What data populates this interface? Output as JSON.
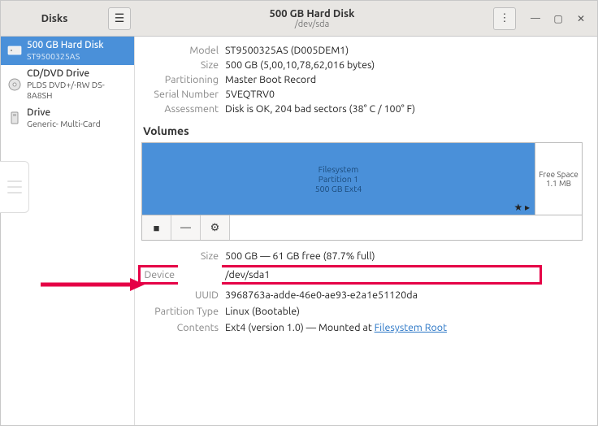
{
  "titlebar": {
    "left_title": "Disks",
    "center_title": "500 GB Hard Disk",
    "center_subtitle": "/dev/sda"
  },
  "sidebar": {
    "items": [
      {
        "main": "500 GB Hard Disk",
        "sub": "ST9500325AS"
      },
      {
        "main": "CD/DVD Drive",
        "sub": "PLDS DVD+/-RW DS-8A8SH"
      },
      {
        "main": "Drive",
        "sub": "Generic- Multi-Card"
      }
    ]
  },
  "disk_props": {
    "model_label": "Model",
    "model": "ST9500325AS (D005DEM1)",
    "size_label": "Size",
    "size": "500 GB (5,00,10,78,62,016 bytes)",
    "partitioning_label": "Partitioning",
    "partitioning": "Master Boot Record",
    "serial_label": "Serial Number",
    "serial": "5VEQTRV0",
    "assessment_label": "Assessment",
    "assessment": "Disk is OK, 204 bad sectors (38° C / 100° F)"
  },
  "volumes": {
    "header": "Volumes",
    "main_fs": "Filesystem",
    "main_part": "Partition 1",
    "main_size": "500 GB Ext4",
    "free_label": "Free Space",
    "free_size": "1.1 MB"
  },
  "partition_props": {
    "size_label": "Size",
    "size": "500 GB — 61 GB free (87.7% full)",
    "device_label": "Device",
    "device": "/dev/sda1",
    "uuid_label": "UUID",
    "uuid": "3968763a-adde-46e0-ae93-e2a1e51120da",
    "ptype_label": "Partition Type",
    "ptype": "Linux (Bootable)",
    "contents_label": "Contents",
    "contents_prefix": "Ext4 (version 1.0) — Mounted at ",
    "contents_link": "Filesystem Root"
  }
}
